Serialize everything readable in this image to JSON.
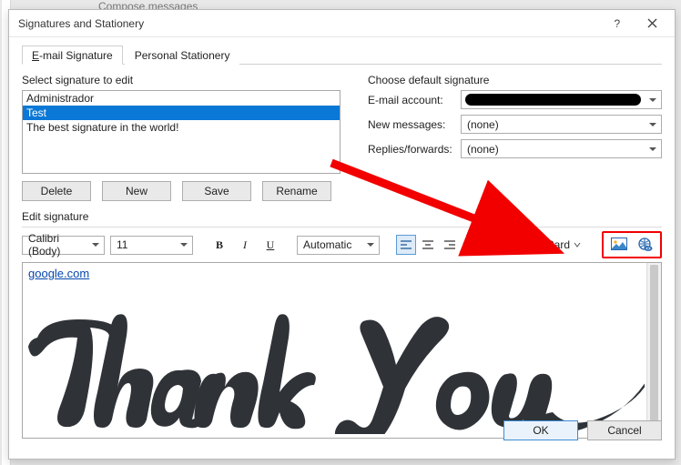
{
  "outer_header": "Compose messages",
  "dialog_title": "Signatures and Stationery",
  "tabs": {
    "signature": "E-mail Signature",
    "stationery": "Personal Stationery"
  },
  "left": {
    "select_label": "Select signature to edit",
    "items": [
      "Administrador",
      "Test",
      "The best signature in the world!"
    ],
    "delete": "Delete",
    "new": "New",
    "save": "Save",
    "rename": "Rename"
  },
  "right": {
    "choose_label": "Choose default signature",
    "account_label": "E-mail account:",
    "newmsg_label": "New messages:",
    "replies_label": "Replies/forwards:",
    "none": "(none)"
  },
  "edit": {
    "label": "Edit signature",
    "font": "Calibri (Body)",
    "size": "11",
    "bold": "B",
    "italic": "I",
    "underline": "U",
    "auto": "Automatic",
    "bizcard": "Business Card",
    "link_text": "google.com"
  },
  "footer": {
    "ok": "OK",
    "cancel": "Cancel"
  }
}
